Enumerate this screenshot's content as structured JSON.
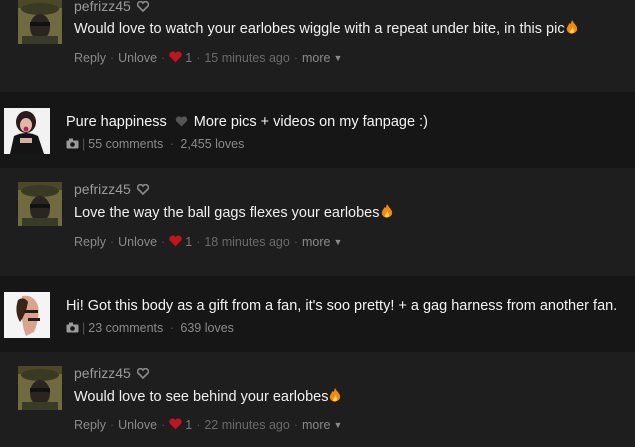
{
  "feed": {
    "items": [
      {
        "kind": "comment",
        "username": "pefrizz45",
        "text": "Would love to watch your earlobes wiggle with a repeat under bite, in this pic",
        "emoji": "fire-emoji",
        "reply_label": "Reply",
        "unlove_label": "Unlove",
        "love_count": "1",
        "time": "15 minutes ago",
        "more_label": "more"
      },
      {
        "kind": "post",
        "text_a": "Pure happiness",
        "text_b": "More pics + videos on my fanpage :)",
        "comments": "55 comments",
        "loves": "2,455 loves"
      },
      {
        "kind": "comment",
        "username": "pefrizz45",
        "text": "Love the way the ball gags flexes your earlobes",
        "emoji": "fire-emoji",
        "reply_label": "Reply",
        "unlove_label": "Unlove",
        "love_count": "1",
        "time": "18 minutes ago",
        "more_label": "more"
      },
      {
        "kind": "post",
        "text_a": "Hi! Got this body as a gift from a fan, it's soo pretty! + a gag harness from another fan.",
        "text_b": "",
        "comments": "23 comments",
        "loves": "639 loves"
      },
      {
        "kind": "comment",
        "username": "pefrizz45",
        "text": "Would love to see behind your earlobes",
        "emoji": "fire-emoji",
        "reply_label": "Reply",
        "unlove_label": "Unlove",
        "love_count": "1",
        "time": "22 minutes ago",
        "more_label": "more"
      }
    ]
  },
  "colors": {
    "heart_red": "#c0151c",
    "muted": "#7a7a7a",
    "row_dark": "#161616",
    "row_comment": "#1e1e1e"
  }
}
